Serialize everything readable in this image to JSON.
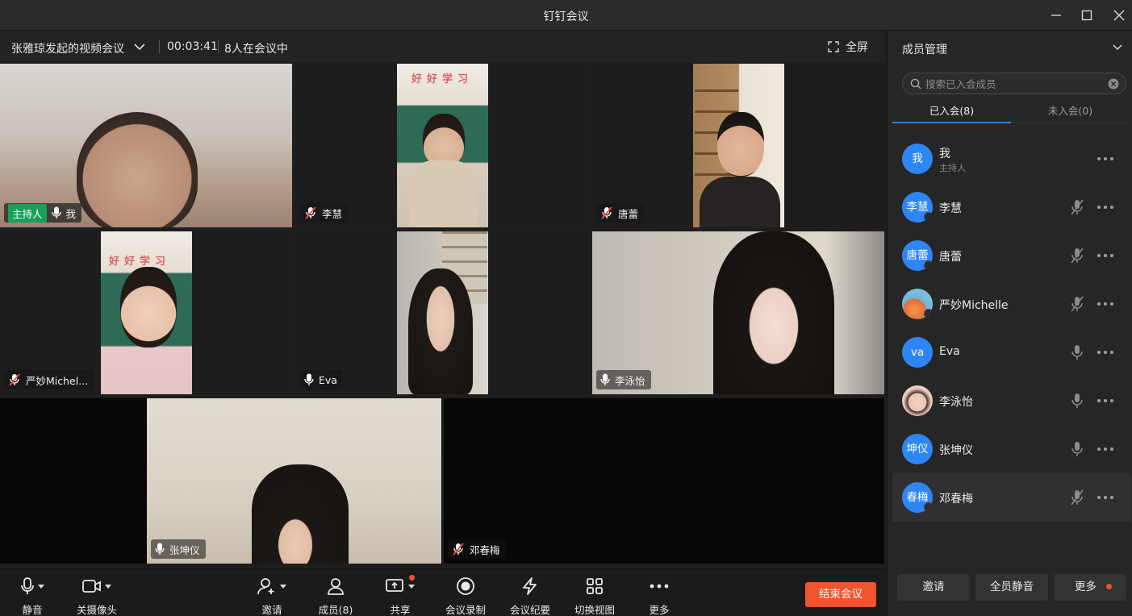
{
  "window": {
    "title": "钉钉会议"
  },
  "infobar": {
    "meeting_title": "张雅琼发起的视频会议",
    "timer": "00:03:41",
    "participant_count": "8人在会议中",
    "fullscreen_label": "全屏"
  },
  "tiles": [
    {
      "name": "我",
      "host_tag": "主持人",
      "muted": false
    },
    {
      "name": "李慧",
      "muted": true
    },
    {
      "name": "唐蕾",
      "muted": true
    },
    {
      "name": "严妙Michel...",
      "muted": true
    },
    {
      "name": "Eva",
      "muted": false
    },
    {
      "name": "李泳怡",
      "muted": false
    },
    {
      "name": "张坤仪",
      "muted": false
    },
    {
      "name": "邓春梅",
      "muted": true
    }
  ],
  "toolbar": {
    "mute": "静音",
    "camera": "关摄像头",
    "invite": "邀请",
    "members": "成员(8)",
    "share": "共享",
    "record": "会议录制",
    "minutes": "会议纪要",
    "switch_view": "切换视图",
    "more": "更多",
    "end": "结束会议"
  },
  "panel": {
    "title": "成员管理",
    "search_placeholder": "搜索已入会成员",
    "tab_joined": "已入会(8)",
    "tab_not_joined": "未入会(0)",
    "members": [
      {
        "avatar": "我",
        "name": "我",
        "sub": "主持人",
        "mic": "none"
      },
      {
        "avatar": "李慧",
        "name": "李慧",
        "mic": "muted"
      },
      {
        "avatar": "唐蕾",
        "name": "唐蕾",
        "mic": "muted"
      },
      {
        "avatar": "",
        "name": "严妙Michelle",
        "mic": "muted"
      },
      {
        "avatar": "va",
        "name": "Eva",
        "mic": "on"
      },
      {
        "avatar": "",
        "name": "李泳怡",
        "mic": "on"
      },
      {
        "avatar": "坤仪",
        "name": "张坤仪",
        "mic": "on"
      },
      {
        "avatar": "春梅",
        "name": "邓春梅",
        "mic": "muted"
      }
    ],
    "btn_invite": "邀请",
    "btn_mute_all": "全员静音",
    "btn_more": "更多"
  },
  "colors": {
    "accent_blue": "#2e86f5",
    "end_red": "#f5532d",
    "host_green": "#18a058"
  }
}
